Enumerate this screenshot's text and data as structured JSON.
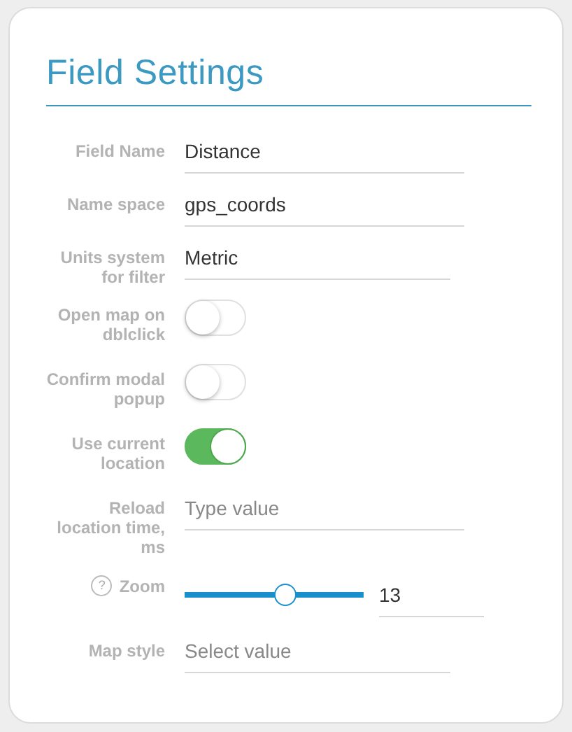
{
  "panel": {
    "title": "Field Settings"
  },
  "fields": [
    {
      "kind": "text",
      "label": "Field Name",
      "value": "Distance"
    },
    {
      "kind": "text",
      "label": "Name space",
      "value": "gps_coords"
    },
    {
      "kind": "select",
      "label": "Units system for filter",
      "value": "Metric"
    },
    {
      "kind": "toggle",
      "label": "Open map on dblclick",
      "on": false
    },
    {
      "kind": "toggle",
      "label": "Confirm modal popup",
      "on": false
    },
    {
      "kind": "toggle",
      "label": "Use current location",
      "on": true
    },
    {
      "kind": "text",
      "label": "Reload location time, ms",
      "placeholder": "Type value"
    },
    {
      "kind": "slider",
      "label": "Zoom",
      "help": "?",
      "level": 0.56,
      "value": "13"
    },
    {
      "kind": "select",
      "label": "Map style",
      "placeholder": "Select value"
    }
  ]
}
